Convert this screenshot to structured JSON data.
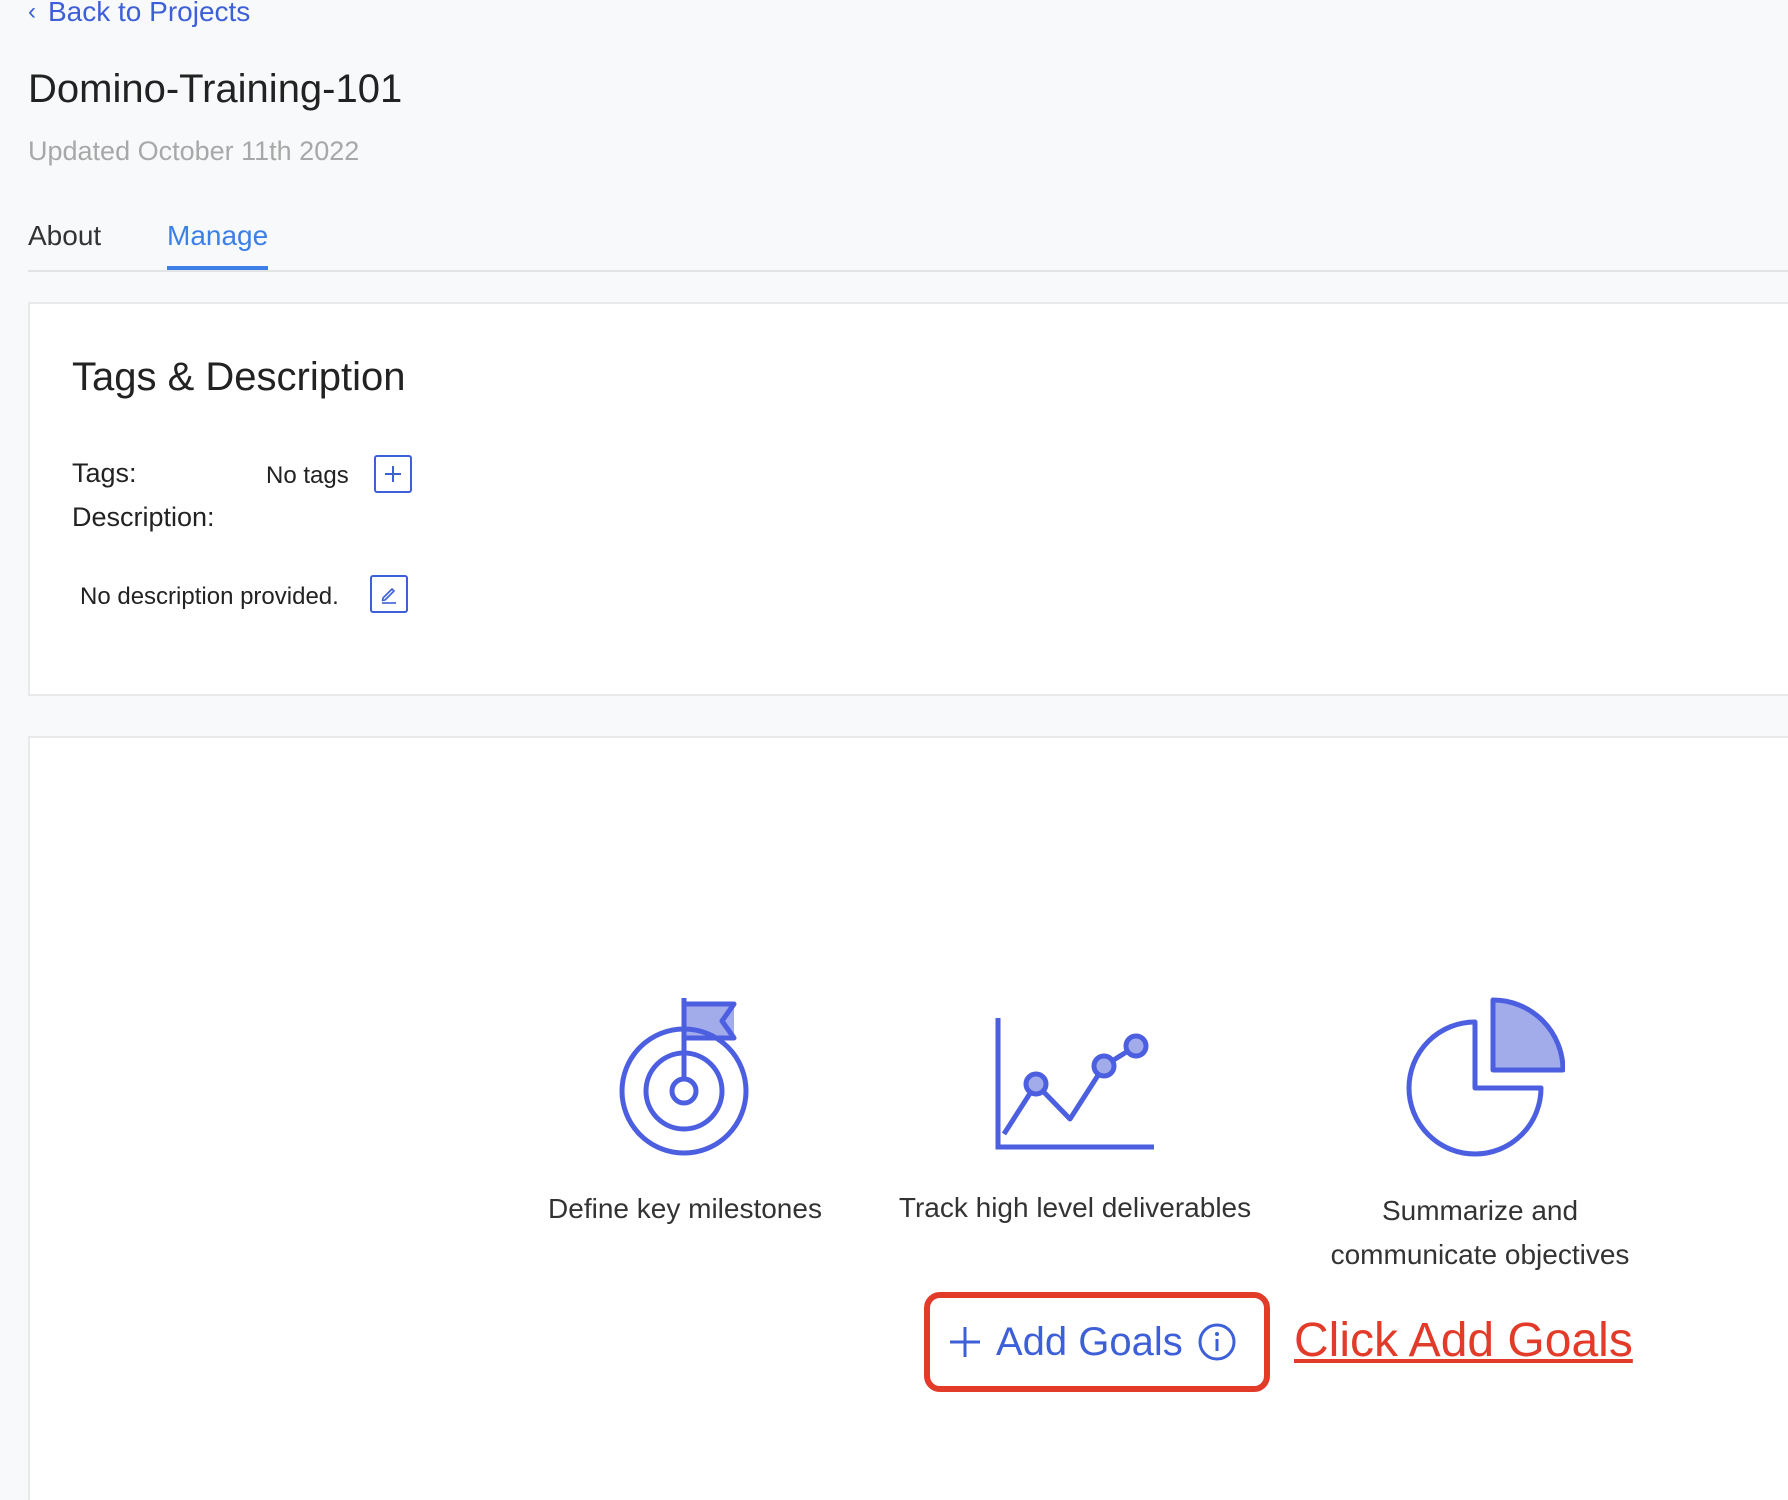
{
  "nav": {
    "back_label": "Back to Projects"
  },
  "project": {
    "title": "Domino-Training-101",
    "updated": "Updated October 11th 2022"
  },
  "tabs": [
    {
      "label": "About",
      "active": false
    },
    {
      "label": "Manage",
      "active": true
    }
  ],
  "tags_card": {
    "title": "Tags & Description",
    "tags_label": "Tags:",
    "tags_value": "No tags",
    "description_label": "Description:",
    "description_value": "No description provided."
  },
  "goals_card": {
    "features": [
      {
        "icon": "target-flag-icon",
        "caption": "Define key milestones"
      },
      {
        "icon": "line-chart-icon",
        "caption": "Track high level deliverables"
      },
      {
        "icon": "pie-chart-icon",
        "caption": "Summarize and communicate objectives"
      }
    ],
    "add_goals_label": "Add Goals"
  },
  "annotation": {
    "text": "Click Add Goals"
  },
  "colors": {
    "accent": "#3d5fd8",
    "tab_active": "#3d7fe6",
    "icon_fill": "#a3acea",
    "highlight": "#e23b2a"
  }
}
